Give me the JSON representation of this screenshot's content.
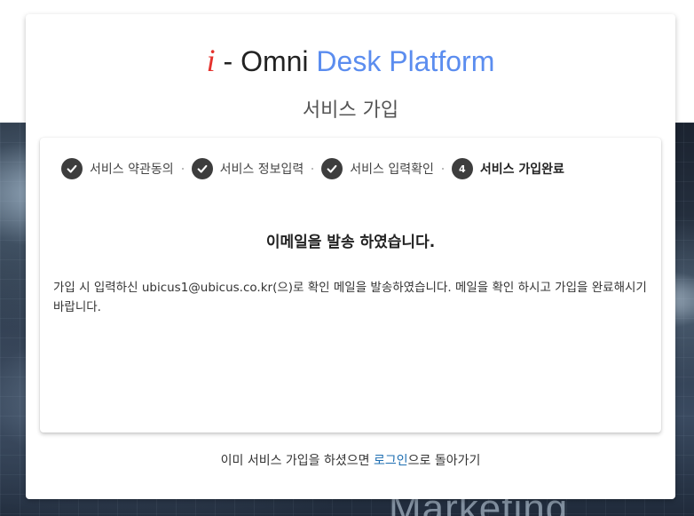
{
  "brand": {
    "i": "i",
    "dash": " - ",
    "omni": "Omni ",
    "desk_platform": "Desk Platform"
  },
  "page_title": "서비스 가입",
  "steps": [
    {
      "label": "서비스 약관동의",
      "state": "done",
      "icon": "check-icon"
    },
    {
      "label": "서비스 정보입력",
      "state": "done",
      "icon": "check-icon"
    },
    {
      "label": "서비스 입력확인",
      "state": "done",
      "icon": "check-icon"
    },
    {
      "label": "서비스 가입완료",
      "state": "active",
      "number": "4"
    }
  ],
  "content": {
    "heading": "이메일을 발송 하였습니다.",
    "message": "가입 시 입력하신 ubicus1@ubicus.co.kr(으)로 확인 메일을 발송하였습니다. 메일을 확인 하시고 가입을 완료해시기 바랍니다."
  },
  "footer": {
    "prefix": "이미 서비스 가입을 하셨으면 ",
    "login_link": "로그인",
    "suffix": "으로 돌아가기"
  },
  "background_text": "Marketing",
  "colors": {
    "brand_red": "#e5322d",
    "brand_blue": "#5b8def",
    "step_dark": "#3d3d3d",
    "link": "#1f6fb2"
  }
}
